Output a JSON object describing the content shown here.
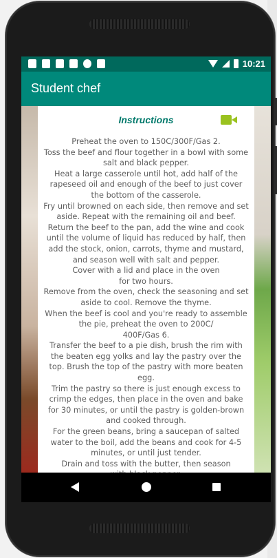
{
  "app": {
    "title": "Student chef"
  },
  "status_bar": {
    "time": "10:21",
    "icons": [
      "shield-icon",
      "gmail-icon",
      "instagram-icon",
      "sd-card-icon",
      "record-icon",
      "play-store-icon",
      "wifi-icon",
      "signal-icon",
      "battery-icon"
    ]
  },
  "section": {
    "heading": "Instructions",
    "video_icon": "video-camera-icon"
  },
  "instructions_text": "Preheat the oven to 150C/300F/Gas 2.\nToss the beef and flour together in a bowl with some salt and black pepper.\nHeat a large casserole until hot, add half of the rapeseed oil and enough of the beef to just cover the bottom of the casserole.\nFry until browned on each side, then remove and set aside. Repeat with the remaining oil and beef.\nReturn the beef to the pan, add the wine and cook until the volume of liquid has reduced by half, then add the stock, onion, carrots, thyme and mustard, and season well with salt and pepper.\nCover with a lid and place in the oven\nfor two hours.\nRemove from the oven, check the seasoning and set aside to cool. Remove the thyme.\nWhen the beef is cool and you're ready to assemble the pie, preheat the oven to 200C/\n400F/Gas 6.\nTransfer the beef to a pie dish, brush the rim with the beaten egg yolks and lay the pastry over the top. Brush the top of the pastry with more beaten egg.\nTrim the pastry so there is just enough excess to crimp the edges, then place in the oven and bake for 30 minutes, or until the pastry is golden-brown and cooked through.\nFor the green beans, bring a saucepan of salted water to the boil, add the beans and cook for 4-5 minutes, or until just tender.\nDrain and toss with the butter, then season\nwith black pepper.\nTo serve, place a large spoonful of pie onto each plate with some green beans alongside.",
  "nav_bar": {
    "back": "back-icon",
    "home": "home-icon",
    "recents": "recents-icon"
  },
  "colors": {
    "status_bar": "#00695c",
    "app_bar": "#00897b",
    "heading": "#00796b",
    "video_icon": "#9ac21f",
    "body_text": "#5d5d5d"
  }
}
